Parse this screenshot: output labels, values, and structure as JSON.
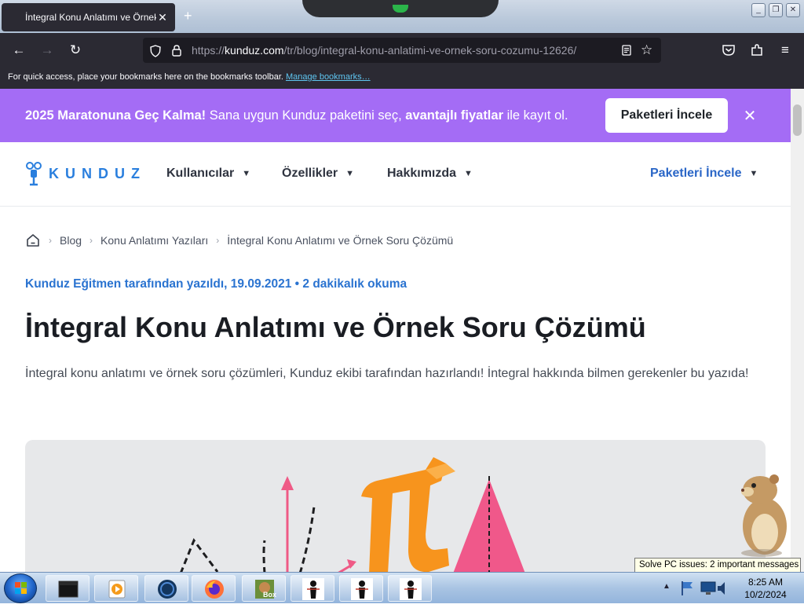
{
  "browser": {
    "tab_title": "İntegral Konu Anlatımı ve Örnek Soru Çözümü",
    "tab_close": "✕",
    "new_tab": "+",
    "url_prefix": "https://",
    "url_domain": "kunduz.com",
    "url_path": "/tr/blog/integral-konu-anlatimi-ve-ornek-soru-cozumu-12626/",
    "bookmarks_message": "For quick access, place your bookmarks here on the bookmarks toolbar.",
    "manage_bookmarks": "Manage bookmarks…"
  },
  "promo": {
    "bold_start": "2025 Maratonuna Geç Kalma!",
    "text_mid": " Sana uygun Kunduz paketini seç, ",
    "bold_mid": "avantajlı fiyatlar",
    "text_end": " ile kayıt ol.",
    "button": "Paketleri İncele",
    "close": "✕"
  },
  "header": {
    "logo": "KUNDUZ",
    "menu": [
      "Kullanıcılar",
      "Özellikler",
      "Hakkımızda"
    ],
    "right_menu": "Paketleri İncele"
  },
  "breadcrumb": [
    "Blog",
    "Konu Anlatımı Yazıları",
    "İntegral Konu Anlatımı ve Örnek Soru Çözümü"
  ],
  "article": {
    "meta": "Kunduz Eğitmen tarafından yazıldı, 19.09.2021 • 2 dakikalık okuma",
    "title": "İntegral Konu Anlatımı ve Örnek Soru Çözümü",
    "lead": "İntegral konu anlatımı ve örnek soru çözümleri, Kunduz ekibi tarafından hazırlandı! İntegral hakkında bilmen gerekenler bu yazıda!"
  },
  "desktop": {
    "tooltip": "Solve PC issues: 2 important messages",
    "clock_time": "8:25 AM",
    "clock_date": "10/2/2024",
    "taskbar_box_label": "Box"
  },
  "colors": {
    "promo_bg": "#a46cf5",
    "brand_blue": "#2a7fde",
    "title_text": "#1a1d23"
  }
}
